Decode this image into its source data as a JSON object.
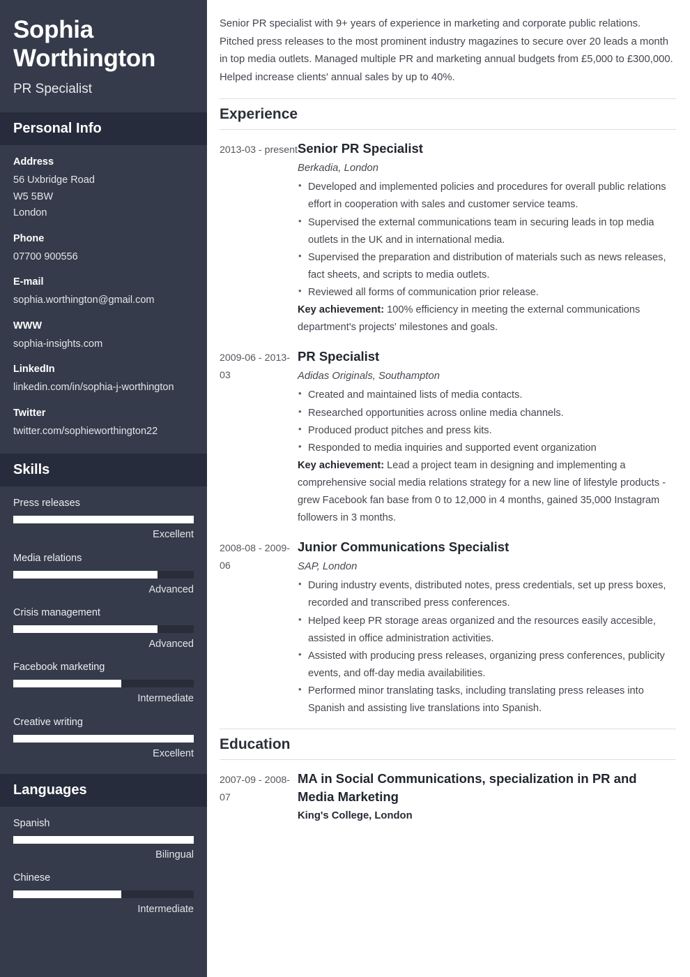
{
  "sidebar": {
    "name": "Sophia Worthington",
    "role": "PR Specialist",
    "personal_info": {
      "heading": "Personal Info",
      "groups": [
        {
          "label": "Address",
          "value": "56 Uxbridge Road\nW5 5BW\nLondon"
        },
        {
          "label": "Phone",
          "value": "07700 900556"
        },
        {
          "label": "E-mail",
          "value": "sophia.worthington@gmail.com"
        },
        {
          "label": "WWW",
          "value": "sophia-insights.com"
        },
        {
          "label": "LinkedIn",
          "value": "linkedin.com/in/sophia-j-worthington"
        },
        {
          "label": "Twitter",
          "value": "twitter.com/sophieworthington22"
        }
      ]
    },
    "skills": {
      "heading": "Skills",
      "items": [
        {
          "name": "Press releases",
          "level": "Excellent",
          "percent": 100
        },
        {
          "name": "Media relations",
          "level": "Advanced",
          "percent": 80
        },
        {
          "name": "Crisis management",
          "level": "Advanced",
          "percent": 80
        },
        {
          "name": "Facebook marketing",
          "level": "Intermediate",
          "percent": 60
        },
        {
          "name": "Creative writing",
          "level": "Excellent",
          "percent": 100
        }
      ]
    },
    "languages": {
      "heading": "Languages",
      "items": [
        {
          "name": "Spanish",
          "level": "Bilingual",
          "percent": 100
        },
        {
          "name": "Chinese",
          "level": "Intermediate",
          "percent": 60
        }
      ]
    }
  },
  "main": {
    "summary": "Senior PR specialist with 9+ years of experience in marketing and corporate public relations. Pitched press releases to the most prominent industry magazines to secure over 20 leads a month in top media outlets. Managed multiple PR and marketing annual budgets from £5,000 to £300,000. Helped increase clients' annual sales by up to 40%.",
    "experience": {
      "heading": "Experience",
      "entries": [
        {
          "dates": "2013-03 - present",
          "title": "Senior PR Specialist",
          "org": "Berkadia, London",
          "bullets": [
            "Developed and implemented policies and procedures for overall public relations effort in cooperation with sales and customer service teams.",
            "Supervised the external communications team in securing leads in top media outlets in the UK and in international media.",
            "Supervised the preparation and distribution of materials such as news releases, fact sheets, and scripts to media outlets.",
            "Reviewed all forms of communication prior release."
          ],
          "key_achievement_label": "Key achievement:",
          "key_achievement": "100% efficiency in meeting the external communications department's projects' milestones and goals."
        },
        {
          "dates": "2009-06 - 2013-03",
          "title": "PR Specialist",
          "org": "Adidas Originals, Southampton",
          "bullets": [
            "Created and maintained lists of media contacts.",
            "Researched opportunities across online media channels.",
            "Produced product pitches and press kits.",
            "Responded to media inquiries and supported event organization"
          ],
          "key_achievement_label": "Key achievement:",
          "key_achievement": "Lead a project team in designing and implementing a comprehensive social media relations strategy for a new line of lifestyle products - grew Facebook fan base from 0 to 12,000 in 4 months, gained 35,000 Instagram followers in 3 months."
        },
        {
          "dates": "2008-08 - 2009-06",
          "title": "Junior Communications Specialist",
          "org": "SAP, London",
          "bullets": [
            "During industry events, distributed notes, press credentials, set up press boxes, recorded and transcribed press conferences.",
            "Helped keep PR storage areas organized and the resources easily accesible, assisted in office administration activities.",
            "Assisted with producing press releases, organizing press conferences, publicity events, and off-day media availabilities.",
            "Performed minor translating tasks, including translating press releases into Spanish and assisting live translations into Spanish."
          ]
        }
      ]
    },
    "education": {
      "heading": "Education",
      "entries": [
        {
          "dates": "2007-09 - 2008-07",
          "title": "MA in Social Communications, specialization in PR and Media Marketing",
          "org": "King's College, London"
        }
      ]
    }
  },
  "colors": {
    "sidebar_bg": "#353b4a",
    "sidebar_band_bg": "#262c3b",
    "bar_track": "#282d39",
    "bar_fill": "#ffffff",
    "main_text": "#44474e",
    "rule": "#dcdee1"
  }
}
